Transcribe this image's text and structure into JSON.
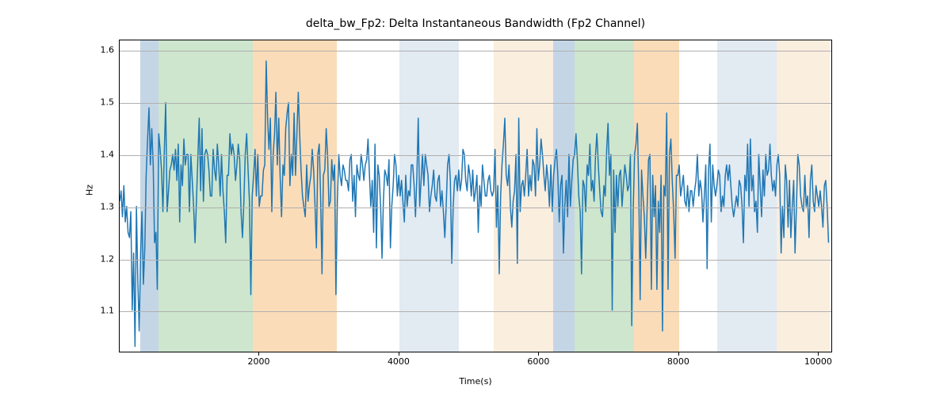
{
  "chart_data": {
    "type": "line",
    "title": "delta_bw_Fp2: Delta Instantaneous Bandwidth (Fp2 Channel)",
    "xlabel": "Time(s)",
    "ylabel": "Hz",
    "xlim": [
      0,
      10200
    ],
    "ylim": [
      1.02,
      1.62
    ],
    "x_ticks": [
      2000,
      4000,
      6000,
      8000,
      10000
    ],
    "y_ticks": [
      1.1,
      1.2,
      1.3,
      1.4,
      1.5,
      1.6
    ],
    "bands": [
      {
        "x0": 300,
        "x1": 550,
        "color": "#c4d6e6"
      },
      {
        "x0": 550,
        "x1": 1900,
        "color": "#cde6cd"
      },
      {
        "x0": 1900,
        "x1": 3100,
        "color": "#fadcb8"
      },
      {
        "x0": 4000,
        "x1": 4850,
        "color": "#e2eaf2"
      },
      {
        "x0": 5350,
        "x1": 6200,
        "color": "#faeedf"
      },
      {
        "x0": 6200,
        "x1": 6500,
        "color": "#c4d6e6"
      },
      {
        "x0": 6500,
        "x1": 7350,
        "color": "#cde6cd"
      },
      {
        "x0": 7350,
        "x1": 8000,
        "color": "#fadcb8"
      },
      {
        "x0": 8550,
        "x1": 9400,
        "color": "#e2eaf2"
      },
      {
        "x0": 9400,
        "x1": 10150,
        "color": "#faeedf"
      }
    ],
    "series": [
      {
        "name": "delta_bw_Fp2",
        "color": "#1f77b4",
        "x_start": 0,
        "x_step": 20,
        "values": [
          1.31,
          1.33,
          1.28,
          1.34,
          1.27,
          1.3,
          1.25,
          1.24,
          1.29,
          1.1,
          1.21,
          1.03,
          1.3,
          1.16,
          1.06,
          1.21,
          1.29,
          1.15,
          1.22,
          1.36,
          1.43,
          1.49,
          1.38,
          1.45,
          1.38,
          1.23,
          1.25,
          1.14,
          1.44,
          1.41,
          1.37,
          1.29,
          1.41,
          1.5,
          1.29,
          1.33,
          1.37,
          1.38,
          1.4,
          1.37,
          1.41,
          1.35,
          1.42,
          1.27,
          1.38,
          1.34,
          1.43,
          1.38,
          1.4,
          1.4,
          1.29,
          1.4,
          1.35,
          1.3,
          1.23,
          1.31,
          1.39,
          1.47,
          1.33,
          1.45,
          1.31,
          1.4,
          1.41,
          1.4,
          1.37,
          1.32,
          1.32,
          1.41,
          1.37,
          1.35,
          1.42,
          1.38,
          1.32,
          1.4,
          1.33,
          1.29,
          1.23,
          1.36,
          1.36,
          1.44,
          1.4,
          1.42,
          1.4,
          1.35,
          1.38,
          1.42,
          1.39,
          1.29,
          1.24,
          1.31,
          1.4,
          1.44,
          1.37,
          1.31,
          1.13,
          1.32,
          1.36,
          1.41,
          1.32,
          1.4,
          1.3,
          1.32,
          1.32,
          1.37,
          1.38,
          1.58,
          1.47,
          1.41,
          1.47,
          1.29,
          1.4,
          1.44,
          1.52,
          1.38,
          1.47,
          1.36,
          1.28,
          1.38,
          1.36,
          1.45,
          1.48,
          1.5,
          1.34,
          1.4,
          1.36,
          1.48,
          1.36,
          1.44,
          1.52,
          1.44,
          1.37,
          1.32,
          1.3,
          1.28,
          1.38,
          1.31,
          1.34,
          1.36,
          1.41,
          1.37,
          1.3,
          1.22,
          1.4,
          1.42,
          1.32,
          1.17,
          1.36,
          1.37,
          1.45,
          1.4,
          1.3,
          1.31,
          1.39,
          1.35,
          1.38,
          1.13,
          1.31,
          1.4,
          1.36,
          1.34,
          1.38,
          1.37,
          1.35,
          1.35,
          1.33,
          1.39,
          1.4,
          1.31,
          1.36,
          1.28,
          1.38,
          1.36,
          1.35,
          1.4,
          1.38,
          1.35,
          1.38,
          1.39,
          1.43,
          1.36,
          1.3,
          1.35,
          1.25,
          1.42,
          1.22,
          1.38,
          1.36,
          1.3,
          1.2,
          1.31,
          1.37,
          1.36,
          1.34,
          1.39,
          1.22,
          1.3,
          1.34,
          1.4,
          1.38,
          1.32,
          1.36,
          1.32,
          1.35,
          1.31,
          1.27,
          1.36,
          1.3,
          1.33,
          1.32,
          1.38,
          1.38,
          1.34,
          1.28,
          1.36,
          1.47,
          1.3,
          1.35,
          1.4,
          1.34,
          1.4,
          1.38,
          1.36,
          1.29,
          1.32,
          1.34,
          1.37,
          1.32,
          1.31,
          1.35,
          1.36,
          1.3,
          1.33,
          1.29,
          1.24,
          1.3,
          1.38,
          1.4,
          1.35,
          1.19,
          1.3,
          1.35,
          1.36,
          1.33,
          1.37,
          1.33,
          1.35,
          1.41,
          1.4,
          1.35,
          1.33,
          1.38,
          1.36,
          1.32,
          1.37,
          1.31,
          1.33,
          1.36,
          1.25,
          1.34,
          1.3,
          1.38,
          1.35,
          1.32,
          1.32,
          1.35,
          1.36,
          1.33,
          1.32,
          1.33,
          1.41,
          1.26,
          1.34,
          1.17,
          1.32,
          1.38,
          1.42,
          1.47,
          1.36,
          1.34,
          1.38,
          1.3,
          1.26,
          1.31,
          1.33,
          1.4,
          1.19,
          1.47,
          1.29,
          1.34,
          1.35,
          1.32,
          1.36,
          1.41,
          1.32,
          1.36,
          1.33,
          1.39,
          1.38,
          1.32,
          1.45,
          1.35,
          1.38,
          1.43,
          1.4,
          1.36,
          1.33,
          1.38,
          1.35,
          1.3,
          1.38,
          1.29,
          1.36,
          1.39,
          1.41,
          1.36,
          1.27,
          1.34,
          1.36,
          1.21,
          1.3,
          1.35,
          1.28,
          1.4,
          1.3,
          1.35,
          1.39,
          1.4,
          1.44,
          1.39,
          1.32,
          1.29,
          1.17,
          1.35,
          1.34,
          1.29,
          1.38,
          1.36,
          1.42,
          1.33,
          1.35,
          1.31,
          1.4,
          1.44,
          1.38,
          1.33,
          1.29,
          1.28,
          1.34,
          1.32,
          1.41,
          1.46,
          1.36,
          1.4,
          1.1,
          1.37,
          1.25,
          1.36,
          1.3,
          1.36,
          1.37,
          1.3,
          1.34,
          1.38,
          1.36,
          1.33,
          1.34,
          1.4,
          1.07,
          1.29,
          1.4,
          1.42,
          1.46,
          1.33,
          1.12,
          1.37,
          1.32,
          1.28,
          1.2,
          1.3,
          1.39,
          1.4,
          1.14,
          1.36,
          1.28,
          1.34,
          1.14,
          1.31,
          1.25,
          1.36,
          1.06,
          1.34,
          1.32,
          1.48,
          1.14,
          1.4,
          1.43,
          1.35,
          1.29,
          1.2,
          1.36,
          1.36,
          1.38,
          1.32,
          1.34,
          1.36,
          1.31,
          1.3,
          1.34,
          1.29,
          1.33,
          1.33,
          1.3,
          1.33,
          1.35,
          1.4,
          1.32,
          1.35,
          1.33,
          1.27,
          1.32,
          1.38,
          1.18,
          1.37,
          1.42,
          1.27,
          1.38,
          1.34,
          1.32,
          1.34,
          1.37,
          1.36,
          1.29,
          1.32,
          1.3,
          1.36,
          1.38,
          1.35,
          1.38,
          1.34,
          1.3,
          1.28,
          1.3,
          1.32,
          1.3,
          1.35,
          1.34,
          1.3,
          1.23,
          1.36,
          1.33,
          1.42,
          1.3,
          1.43,
          1.33,
          1.36,
          1.29,
          1.31,
          1.25,
          1.4,
          1.34,
          1.28,
          1.37,
          1.32,
          1.4,
          1.36,
          1.37,
          1.42,
          1.36,
          1.33,
          1.35,
          1.32,
          1.38,
          1.4,
          1.36,
          1.21,
          1.3,
          1.24,
          1.38,
          1.35,
          1.26,
          1.35,
          1.24,
          1.3,
          1.35,
          1.21,
          1.3,
          1.4,
          1.38,
          1.32,
          1.3,
          1.29,
          1.36,
          1.3,
          1.32,
          1.24,
          1.35,
          1.38,
          1.31,
          1.29,
          1.34,
          1.32,
          1.3,
          1.33,
          1.3,
          1.26,
          1.34,
          1.35,
          1.3,
          1.23
        ]
      }
    ]
  }
}
